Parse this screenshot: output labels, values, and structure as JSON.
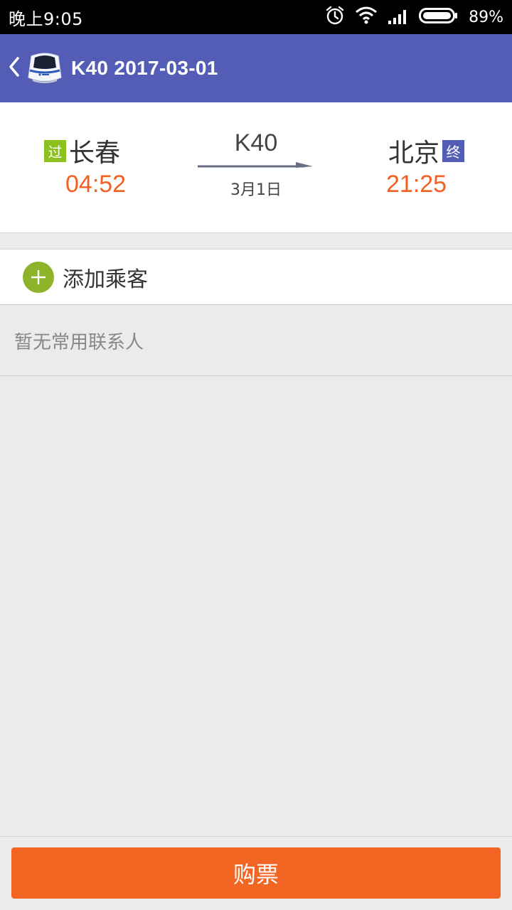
{
  "status_bar": {
    "time": "晚上9:05",
    "battery_pct": "89%",
    "icons": [
      "alarm-icon",
      "wifi-icon",
      "signal-icon",
      "battery-icon"
    ]
  },
  "app_bar": {
    "back_icon": "chevron-left-icon",
    "logo_icon": "train-icon",
    "title": "K40  2017-03-01",
    "color": "#535db5"
  },
  "trip": {
    "from": {
      "tag": "过",
      "name": "长春",
      "time": "04:52",
      "tag_color": "#8cc21f"
    },
    "to": {
      "tag": "终",
      "name": "北京",
      "time": "21:25",
      "tag_color": "#535db5"
    },
    "train_no": "K40",
    "date": "3月1日",
    "time_color": "#f26024"
  },
  "passengers": {
    "add_label": "添加乘客",
    "add_icon": "plus-circle-icon",
    "empty_text": "暂无常用联系人"
  },
  "footer": {
    "buy_label": "购票",
    "button_color": "#f26522"
  }
}
